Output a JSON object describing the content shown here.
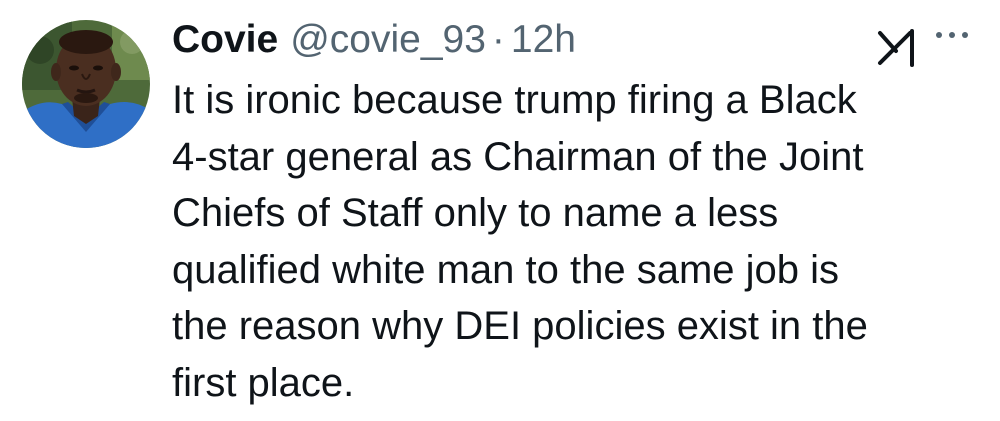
{
  "tweet": {
    "author": {
      "display_name": "Covie",
      "handle": "@covie_93",
      "avatar_icon": "profile-photo"
    },
    "separator": "·",
    "timestamp": "12h",
    "text_lines": [
      "It is ironic because trump firing a Black",
      "4-star general as Chairman of the Joint",
      "Chiefs of Staff only to name a less",
      "qualified white man to the same job is",
      "the reason why DEI policies exist in the",
      "first place."
    ]
  },
  "icons": {
    "grok": "grok-icon",
    "more": "more-dots-icon"
  },
  "colors": {
    "text": "#0f1419",
    "secondary": "#536471",
    "background": "#ffffff"
  }
}
